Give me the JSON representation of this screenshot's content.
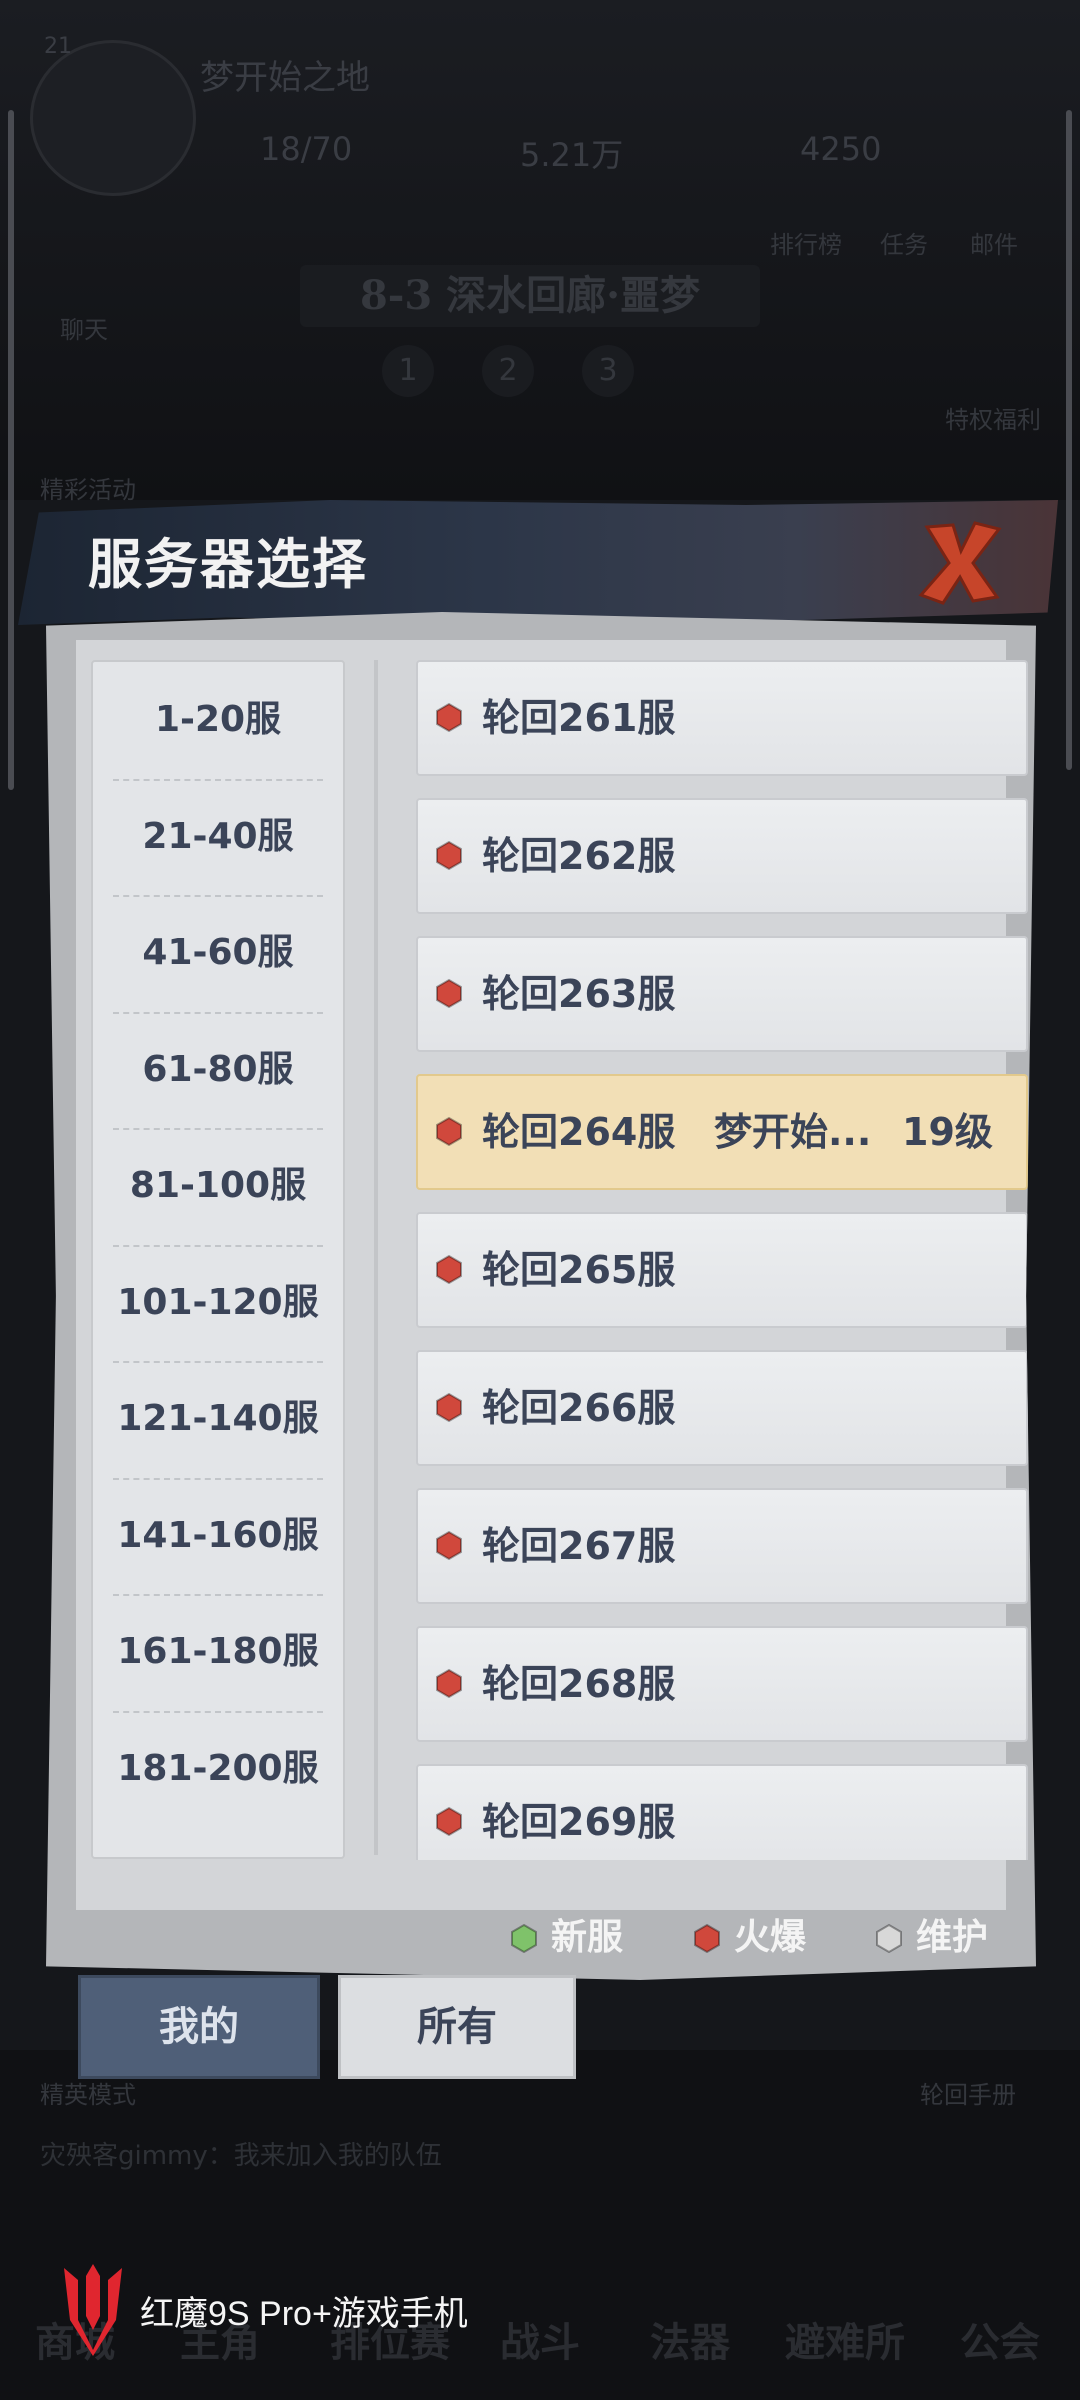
{
  "background": {
    "player_level": "21",
    "player_name": "梦开始之地",
    "resources": [
      "18/70",
      "5.21万",
      "4250"
    ],
    "top_icons": [
      "排行榜",
      "任务",
      "邮件"
    ],
    "stage_title": "8-3 深水回廊·噩梦",
    "stage_steps": [
      "1",
      "2",
      "3"
    ],
    "side_labels": [
      "聊天",
      "精彩活动",
      "特权福利"
    ],
    "chat_line": "灾殃客gimmy：我来加入我的队伍",
    "mode_label": "精英模式",
    "handbook_label": "轮回手册",
    "bottom_nav": [
      "商城",
      "主角",
      "排位赛",
      "战斗",
      "法器",
      "避难所",
      "公会"
    ]
  },
  "modal": {
    "title": "服务器选择",
    "close_label": "X",
    "ranges": [
      "1-20服",
      "21-40服",
      "41-60服",
      "61-80服",
      "81-100服",
      "101-120服",
      "121-140服",
      "141-160服",
      "161-180服",
      "181-200服"
    ],
    "servers": [
      {
        "name": "轮回261服",
        "status": "hot"
      },
      {
        "name": "轮回262服",
        "status": "hot"
      },
      {
        "name": "轮回263服",
        "status": "hot"
      },
      {
        "name": "轮回264服",
        "status": "hot",
        "character": "梦开始...",
        "level": "19级",
        "selected": true
      },
      {
        "name": "轮回265服",
        "status": "hot"
      },
      {
        "name": "轮回266服",
        "status": "hot"
      },
      {
        "name": "轮回267服",
        "status": "hot"
      },
      {
        "name": "轮回268服",
        "status": "hot"
      },
      {
        "name": "轮回269服",
        "status": "hot"
      }
    ],
    "legend": [
      {
        "label": "新服",
        "color": "#7fc26a"
      },
      {
        "label": "火爆",
        "color": "#d0483c"
      },
      {
        "label": "维护",
        "color": "#d8d8d8"
      }
    ],
    "tabs": {
      "mine": "我的",
      "all": "所有"
    }
  },
  "watermark": {
    "text": "红魔9S Pro+游戏手机"
  },
  "colors": {
    "hot": "#d0483c",
    "new": "#7fc26a",
    "maintenance": "#d8d8d8",
    "selected_row": "#f2dfb6"
  }
}
